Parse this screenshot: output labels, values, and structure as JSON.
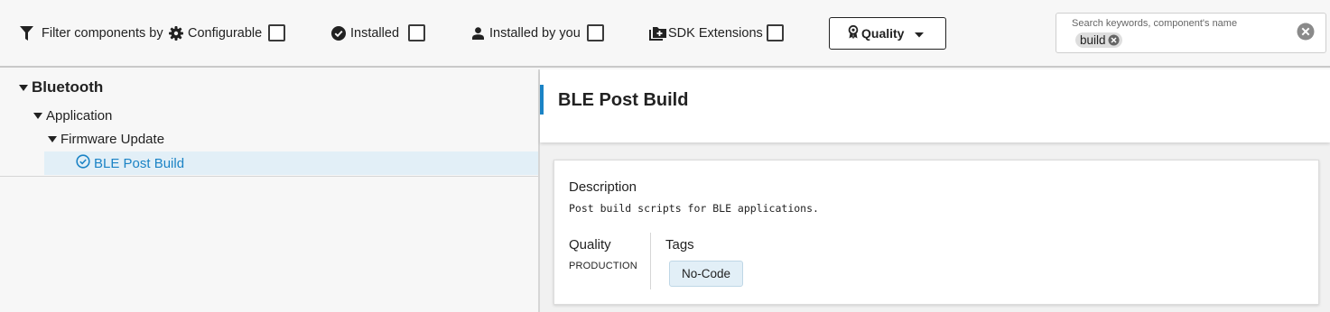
{
  "toolbar": {
    "filter_label": "Filter components by",
    "filters": [
      {
        "label": "Configurable",
        "icon": "gear-icon",
        "checked": false
      },
      {
        "label": "Installed",
        "icon": "check-circle-icon",
        "checked": false
      },
      {
        "label": "Installed by you",
        "icon": "person-icon",
        "checked": false
      },
      {
        "label": "SDK Extensions",
        "icon": "folder-plus-icon",
        "checked": false
      }
    ],
    "quality_label": "Quality",
    "search": {
      "placeholder": "Search keywords, component's name",
      "chip": "build"
    }
  },
  "tree": {
    "root": "Bluetooth",
    "child": "Application",
    "grandchild": "Firmware Update",
    "selected": "BLE Post Build"
  },
  "detail": {
    "title": "BLE Post Build",
    "description_heading": "Description",
    "description": "Post build scripts for BLE applications.",
    "quality_heading": "Quality",
    "quality_value": "PRODUCTION",
    "tags_heading": "Tags",
    "tags": [
      "No-Code"
    ]
  },
  "colors": {
    "accent": "#1b83c5",
    "selected_bg": "#e2eff7"
  }
}
